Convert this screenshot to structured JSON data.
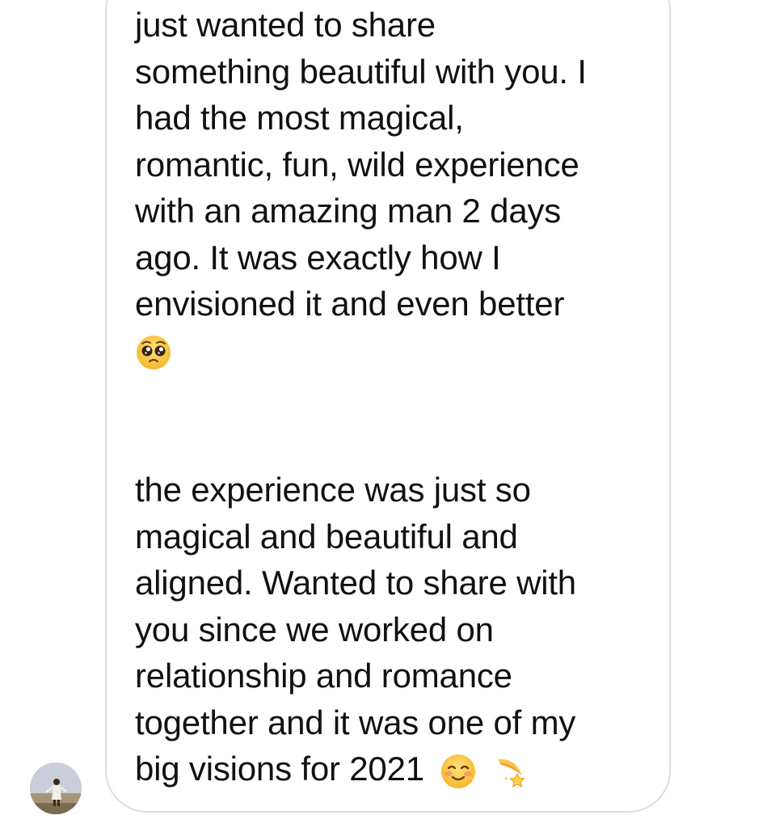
{
  "message": {
    "paragraph1": [
      "just wanted to share",
      "something beautiful with you. I",
      "had the most magical,",
      "romantic, fun, wild experience",
      "with an amazing man 2 days",
      "ago. It was exactly how I",
      "envisioned it and even better"
    ],
    "paragraph1_end_emoji": "pleading-face-emoji",
    "paragraph2": [
      "the experience was just so",
      "magical and beautiful and",
      "aligned. Wanted to share with",
      "you since we worked on",
      "relationship and romance",
      "together and it was one of my",
      "big visions for 2021"
    ],
    "paragraph2_end_emojis": [
      "smiling-face-emoji",
      "dizzy-emoji"
    ]
  },
  "sender": {
    "avatar_icon": "profile-avatar"
  },
  "colors": {
    "bubble_border": "#dedede",
    "text": "#111111",
    "background": "#ffffff"
  }
}
